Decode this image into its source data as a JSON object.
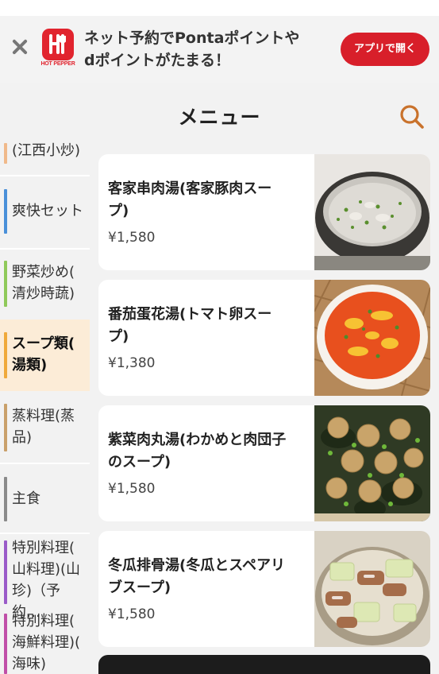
{
  "banner": {
    "logo_text": "HOT PEPPER",
    "message_line1": "ネット予約でPontaポイントや",
    "message_line2": "dポイントがたまる！",
    "open_app_label": "アプリで開く",
    "close_icon": "close-icon"
  },
  "header": {
    "title": "メニュー",
    "search_icon": "search-icon"
  },
  "sidebar": {
    "items": [
      {
        "label_line1": "(江西小炒)",
        "label_line2": "",
        "label_line3": "",
        "accent": "#f0b98a"
      },
      {
        "label_line1": "爽快セット",
        "label_line2": "",
        "label_line3": "",
        "accent": "#4a90d9"
      },
      {
        "label_line1": "野菜炒め(",
        "label_line2": "清炒時蔬)",
        "label_line3": "",
        "accent": "#8fc95a"
      },
      {
        "label_line1": "スープ類(",
        "label_line2": "湯類)",
        "label_line3": "",
        "accent": "#f0a93a"
      },
      {
        "label_line1": "蒸料理(蒸",
        "label_line2": "品)",
        "label_line3": "",
        "accent": "#c9a06a"
      },
      {
        "label_line1": "主食",
        "label_line2": "",
        "label_line3": "",
        "accent": "#8a8a8a"
      },
      {
        "label_line1": "特別料理(",
        "label_line2": "山料理)(山",
        "label_line3": "珍)（予約…",
        "accent": "#9a5bc8"
      },
      {
        "label_line1": "特別料理(",
        "label_line2": "海鮮料理)(",
        "label_line3": "海味)（予…",
        "accent": "#c04fa8"
      }
    ],
    "active_index": 3
  },
  "menu": {
    "items": [
      {
        "name_line1": "客家串肉湯(客家豚肉スー",
        "name_line2": "プ)",
        "price": "¥1,580",
        "photo": "pork-soup-photo"
      },
      {
        "name_line1": "番茄蛋花湯(トマト卵スー",
        "name_line2": "プ)",
        "price": "¥1,380",
        "photo": "tomato-egg-soup-photo"
      },
      {
        "name_line1": "紫菜肉丸湯(わかめと肉団子",
        "name_line2": "のスープ)",
        "price": "¥1,580",
        "photo": "seaweed-meatball-soup-photo"
      },
      {
        "name_line1": "冬瓜排骨湯(冬瓜とスペアリ",
        "name_line2": "ブスープ)",
        "price": "¥1,580",
        "photo": "winter-melon-rib-soup-photo"
      }
    ]
  },
  "colors": {
    "brand_red": "#d81f2a",
    "active_bg": "#fcecd7",
    "search_icon": "#c9722c"
  }
}
